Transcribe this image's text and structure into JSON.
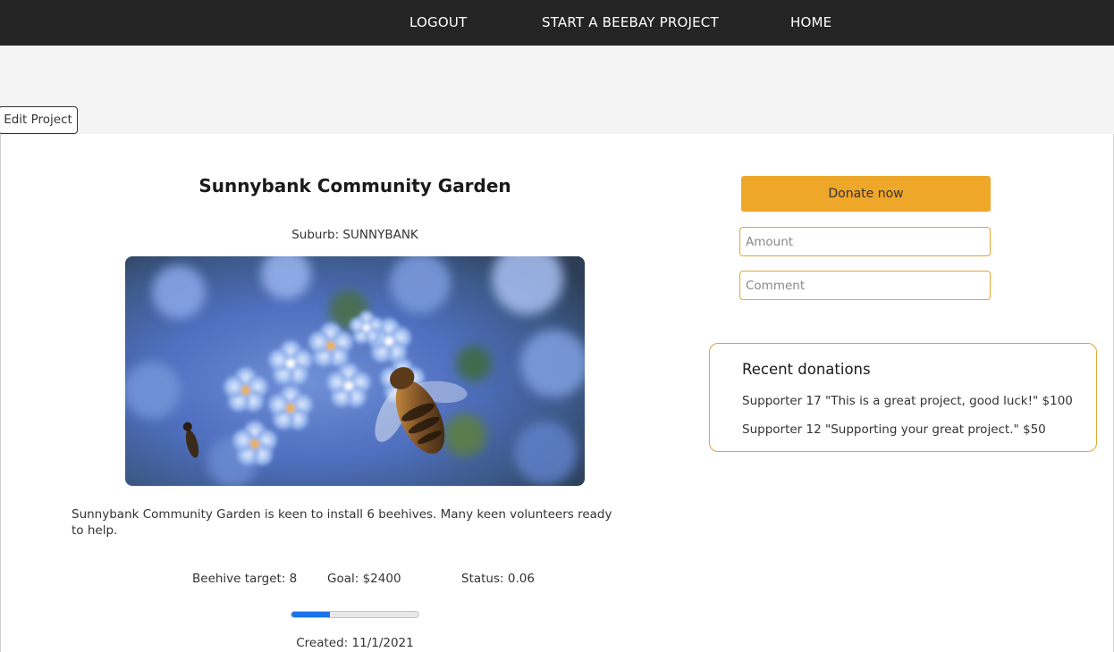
{
  "nav": {
    "logout": "LOGOUT",
    "start_project": "START A BEEBAY PROJECT",
    "home": "HOME"
  },
  "edit_button": "Edit Project",
  "project": {
    "title": "Sunnybank Community Garden",
    "suburb_text": "Suburb: SUNNYBANK",
    "image_alt": "Bee on blue forget-me-not flowers",
    "description": "Sunnybank Community Garden is keen to install 6 beehives. Many keen volunteers ready to help.",
    "beehive_target_text": "Beehive target: 8",
    "goal_text": "Goal: $2400",
    "status_text": "Status: 0.06",
    "progress_fraction": 0.3,
    "created_text": "Created: 11/1/2021"
  },
  "donate": {
    "button_label": "Donate now",
    "amount_placeholder": "Amount",
    "comment_placeholder": "Comment"
  },
  "recent_donations": {
    "title": "Recent donations",
    "items": [
      "Supporter 17 \"This is a great project, good luck!\" $100",
      "Supporter 12 \"Supporting your great project.\" $50"
    ]
  },
  "colors": {
    "nav_bg": "#242424",
    "accent": "#efa72a",
    "progress": "#1a73e8"
  }
}
